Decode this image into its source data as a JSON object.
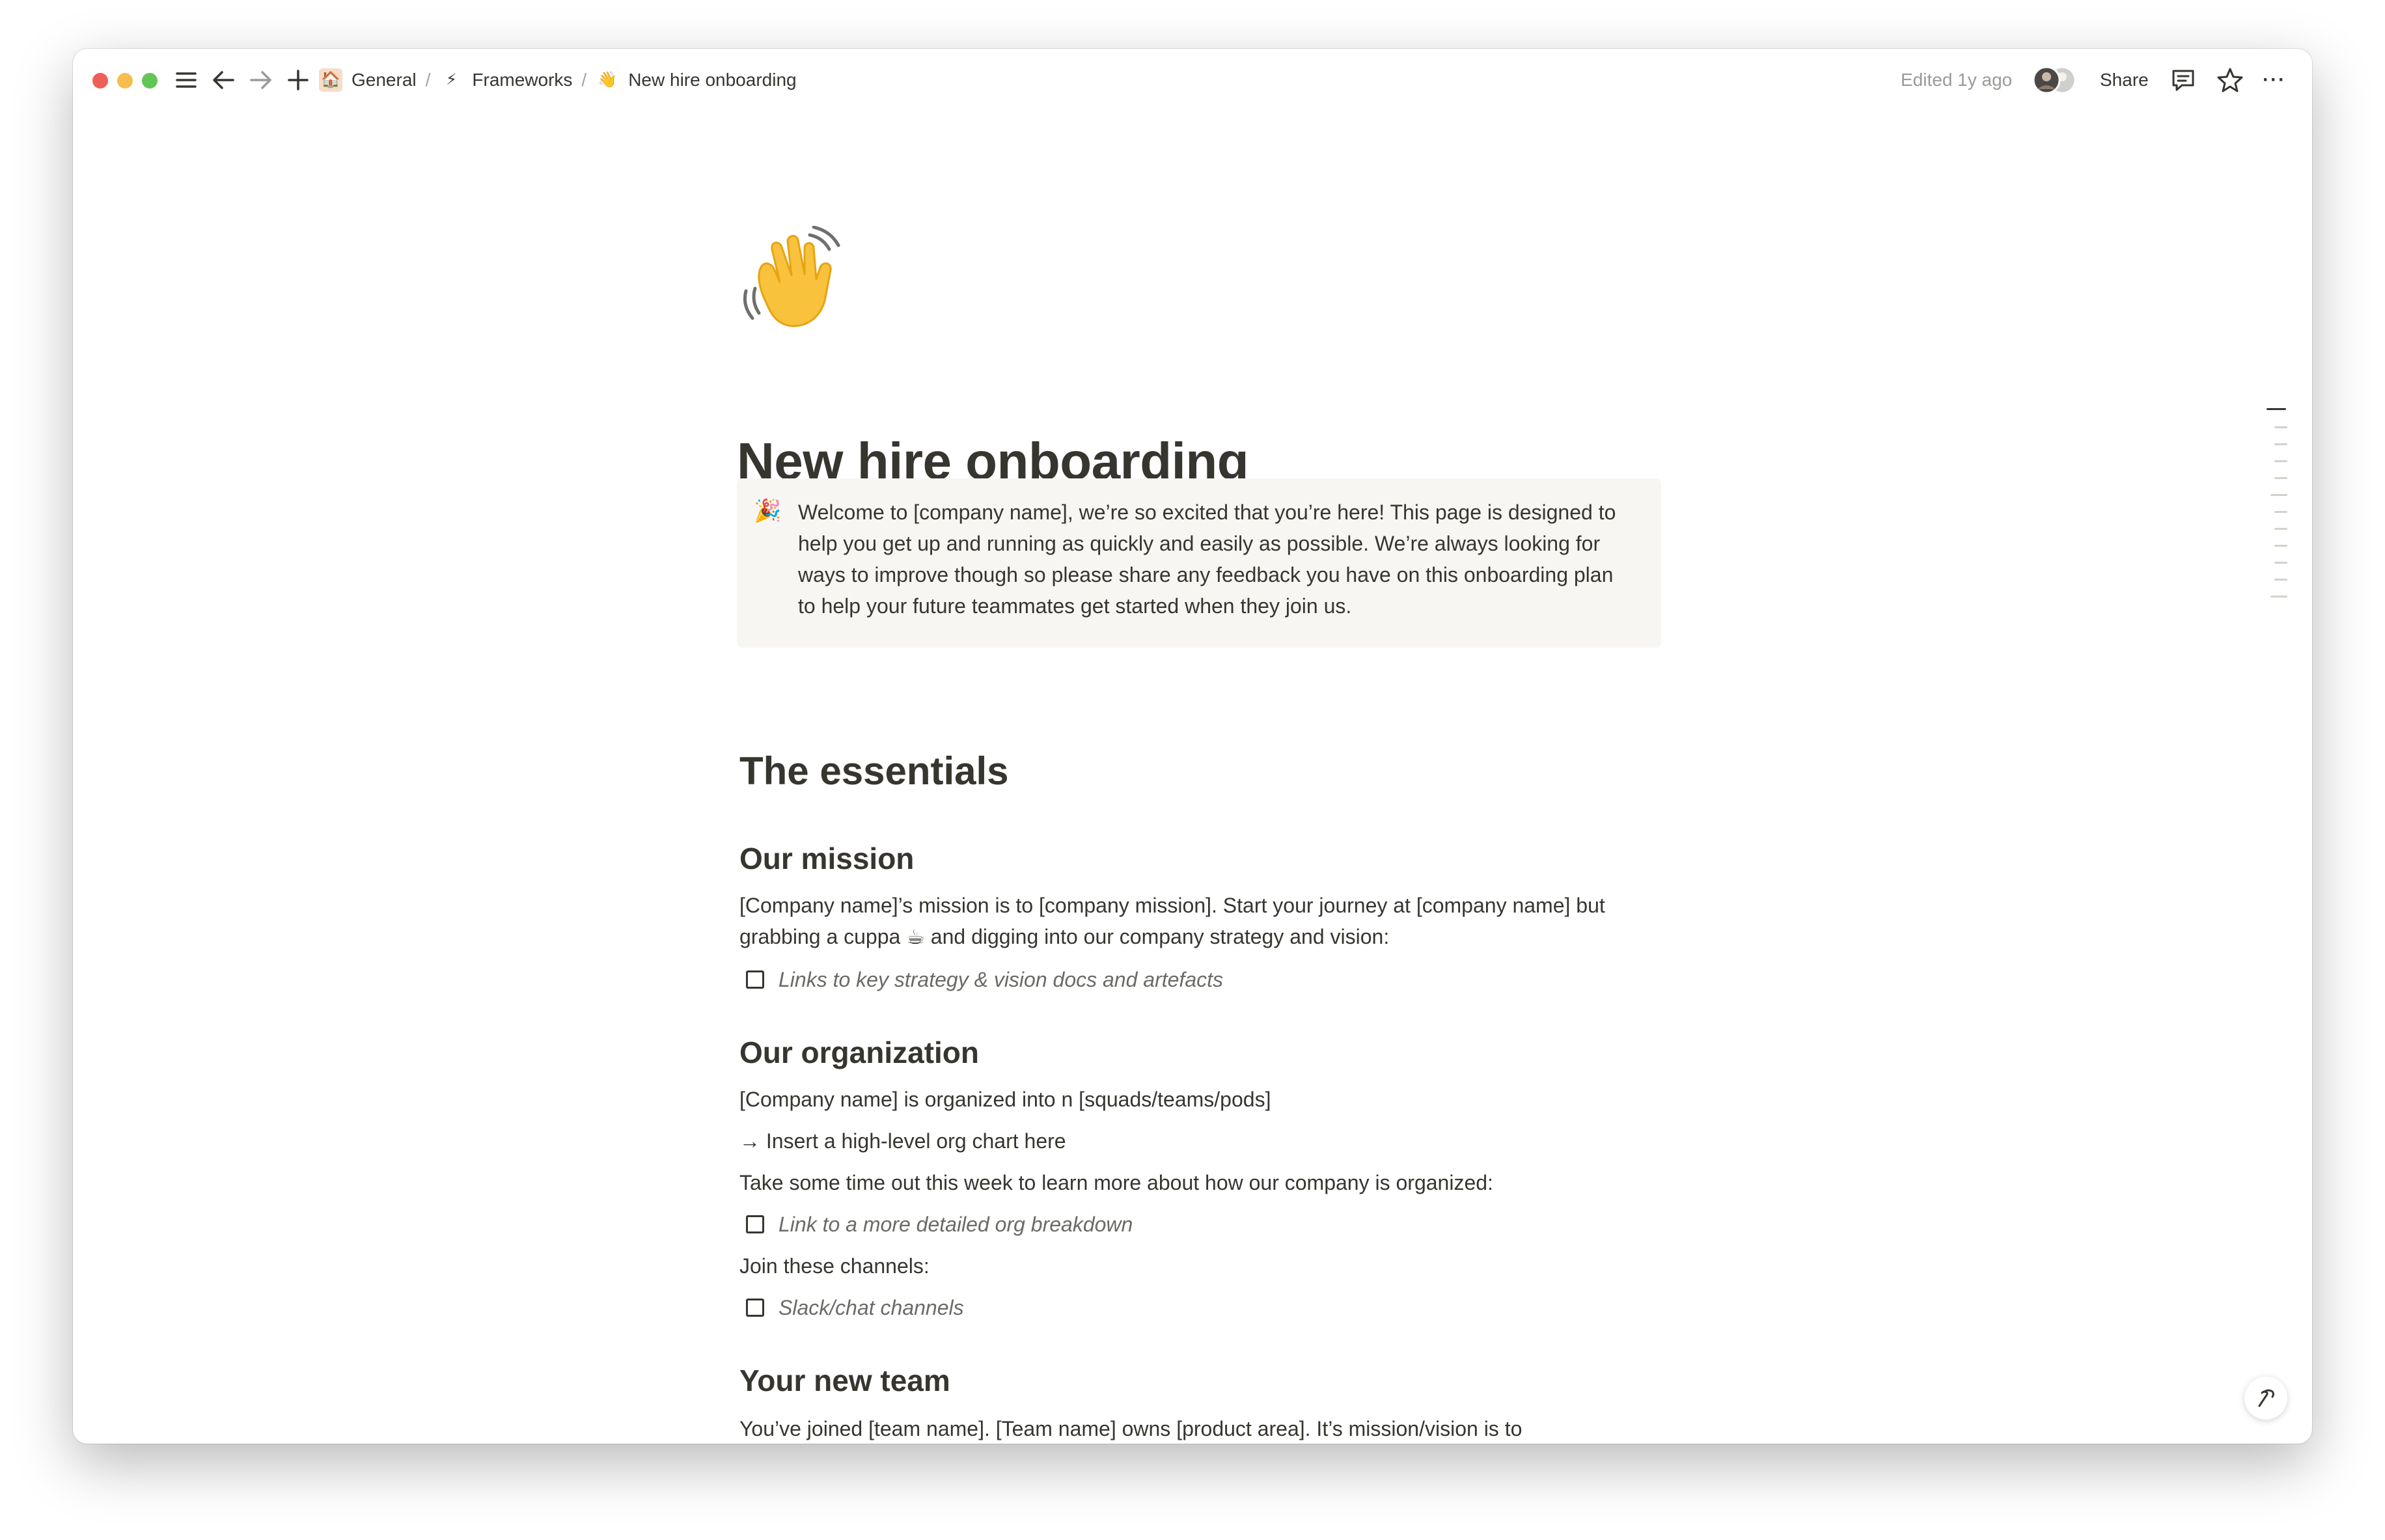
{
  "breadcrumb": [
    {
      "icon": "house-icon",
      "label": "General"
    },
    {
      "icon": "lightning-icon",
      "label": "Frameworks"
    },
    {
      "icon": "waving-hand-icon",
      "label": "New hire onboarding"
    }
  ],
  "breadcrumb_glyphs": {
    "house": "🏠",
    "lightning": "⚡",
    "wave": "👋"
  },
  "header": {
    "edited": "Edited 1y ago",
    "share_label": "Share",
    "more_label": "···"
  },
  "page": {
    "icon": "waving-hand-icon",
    "icon_glyph": "👋",
    "title": "New hire onboarding",
    "callout": {
      "icon": "party-popper-icon",
      "icon_glyph": "🎉",
      "text": "Welcome to [company name], we’re so excited that you’re here! This page is designed to help you get up and running as quickly and easily as possible. We’re always looking for ways to improve though so please share any feedback you have on this onboarding plan to help your future teammates get started when they join us."
    },
    "essentials_heading": "The essentials",
    "mission": {
      "heading": "Our mission",
      "text": "[Company name]’s mission is to [company mission]. Start your journey at [company name] but grabbing a cuppa ☕ and digging into our company strategy and vision:",
      "todo": "Links to key strategy & vision docs and artefacts"
    },
    "organization": {
      "heading": "Our organization",
      "line1": "[Company name] is organized into n [squads/teams/pods]",
      "line2": "→ Insert a high-level org chart here",
      "line3": "Take some time out this week to learn more about how our company is organized:",
      "todo1": "Link to a more detailed org breakdown",
      "line4": "Join these channels:",
      "todo2": "Slack/chat channels"
    },
    "team": {
      "heading": "Your new team",
      "text": "You’ve joined [team name]. [Team name] owns [product area]. It’s mission/vision is to [mission/vision statement]"
    }
  },
  "colors": {
    "text": "#37352f",
    "muted": "#6b6a66",
    "callout_bg": "#f7f6f3",
    "accent_house": "#f0a875"
  }
}
